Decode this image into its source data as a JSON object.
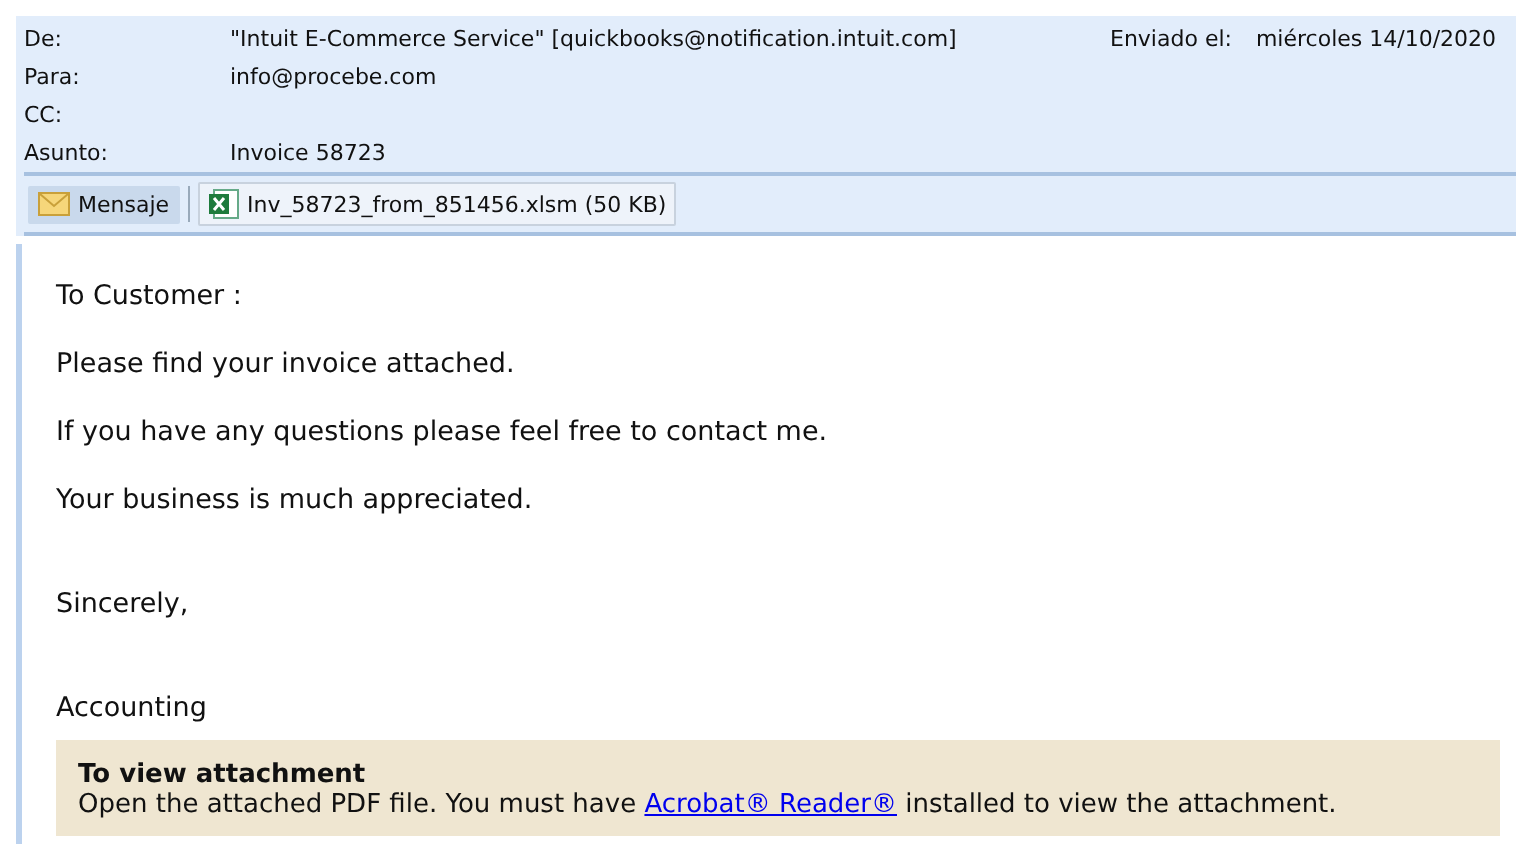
{
  "header": {
    "fields": [
      {
        "label": "De:",
        "value": "\"Intuit E-Commerce Service\" [quickbooks@notification.intuit.com]"
      },
      {
        "label": "Para:",
        "value": "info@procebe.com"
      },
      {
        "label": "CC:"
      },
      {
        "label": "Asunto:",
        "value": "Invoice 58723"
      }
    ],
    "sent": {
      "label": "Enviado el:",
      "value": "miércoles 14/10/2020"
    }
  },
  "toolbar": {
    "items": [
      {
        "kind": "message",
        "label": "Mensaje",
        "selected": true
      },
      {
        "kind": "attachment",
        "label": "Inv_58723_from_851456.xlsm (50 KB)",
        "selected": false
      }
    ]
  },
  "body": {
    "paragraphs": [
      "To Customer :",
      "Please find your invoice attached.",
      "If you have any questions please feel free to contact me.",
      "Your business is much appreciated.",
      "Sincerely,",
      "Accounting"
    ],
    "notice": {
      "title": "To view attachment",
      "before": "Open the attached PDF file. You must have ",
      "link": "Acrobat® Reader®",
      "after": " installed to view the attachment."
    }
  }
}
